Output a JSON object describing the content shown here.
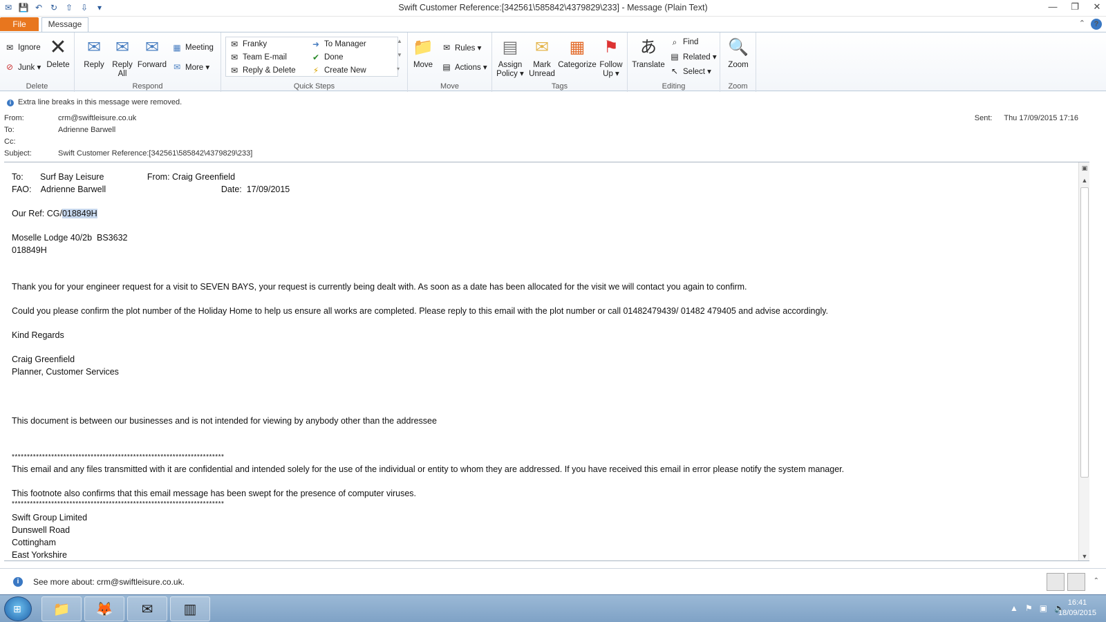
{
  "window": {
    "title": "Swift Customer Reference:[342561\\585842\\4379829\\233]  -  Message (Plain Text)",
    "minimize": "—",
    "restore": "❐",
    "close": "✕"
  },
  "tabs": {
    "file": "File",
    "message": "Message"
  },
  "ribbon": {
    "delete_group": {
      "label": "Delete",
      "ignore": "Ignore",
      "junk": "Junk ▾",
      "delete": "Delete"
    },
    "respond_group": {
      "label": "Respond",
      "reply": "Reply",
      "reply_all_1": "Reply",
      "reply_all_2": "All",
      "forward": "Forward",
      "meeting": "Meeting",
      "more": "More ▾"
    },
    "quick_steps": {
      "label": "Quick Steps",
      "items": [
        "Franky",
        "Team E-mail",
        "Reply & Delete",
        "To Manager",
        "Done",
        "Create New"
      ]
    },
    "move_group": {
      "label": "Move",
      "move": "Move",
      "rules": "Rules ▾",
      "actions": "Actions ▾"
    },
    "tags_group": {
      "label": "Tags",
      "assign_1": "Assign",
      "assign_2": "Policy ▾",
      "mark_1": "Mark",
      "mark_2": "Unread",
      "categorize": "Categorize",
      "follow_1": "Follow",
      "follow_2": "Up ▾"
    },
    "editing_group": {
      "label": "Editing",
      "translate": "Translate",
      "find": "Find",
      "related": "Related ▾",
      "select": "Select ▾"
    },
    "zoom_group": {
      "label": "Zoom",
      "zoom": "Zoom"
    }
  },
  "header": {
    "info": "Extra line breaks in this message were removed.",
    "from_label": "From:",
    "from": "crm@swiftleisure.co.uk",
    "to_label": "To:",
    "to": "Adrienne Barwell",
    "cc_label": "Cc:",
    "cc": "",
    "subject_label": "Subject:",
    "subject": "Swift Customer Reference:[342561\\585842\\4379829\\233]",
    "sent_label": "Sent:",
    "sent": "Thu 17/09/2015 17:16"
  },
  "body": {
    "l1": "To:       Surf Bay Leisure                  From: Craig Greenfield",
    "l2": "FAO:    Adrienne Barwell                                                Date:  17/09/2015",
    "ref_prefix": "Our Ref: CG/",
    "ref_highlight": "018849H",
    "l4": "Moselle Lodge 40/2b  BS3632",
    "l5": "018849H",
    "l6": "Thank you for your engineer request for a visit to SEVEN BAYS, your request is currently being dealt with. As soon as a date has been allocated for the visit we will contact you again to confirm.",
    "l7": "Could you please confirm the plot number of the Holiday Home to help us ensure all works are completed. Please reply to this email with the plot number or call 01482479439/ 01482 479405 and advise accordingly.",
    "l8": "Kind Regards",
    "l9": "Craig Greenfield",
    "l10": "Planner, Customer Services",
    "l11": "This document is between our businesses and is not intended for viewing by anybody other than the addressee",
    "stars": "**********************************************************************",
    "l12": "This email and any files transmitted with it are confidential and intended solely for the use of the individual or entity to whom they are addressed. If you have received this email in error please notify the system manager.",
    "l13": "This footnote also confirms that this email message has been swept for the presence of computer viruses.",
    "l14": "Swift Group Limited",
    "l15": "Dunswell Road",
    "l16": "Cottingham",
    "l17": "East Yorkshire"
  },
  "people_pane": {
    "text": "See more about: crm@swiftleisure.co.uk."
  },
  "taskbar": {
    "time": "16:41",
    "date": "18/09/2015"
  },
  "colors": {
    "accent": "#e8761e",
    "highlight": "#c7d8ee",
    "info_blue": "#3a78c3"
  }
}
